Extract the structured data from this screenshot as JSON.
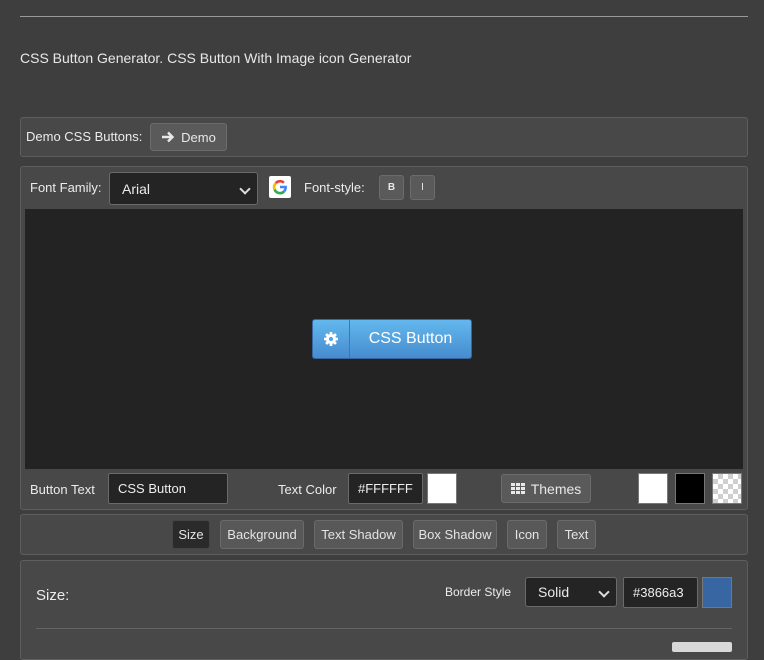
{
  "headline": "CSS Button Generator. CSS Button With Image icon Generator",
  "demo": {
    "label": "Demo CSS Buttons:",
    "button_label": "Demo"
  },
  "font": {
    "family_label": "Font Family:",
    "family_value": "Arial",
    "style_label": "Font-style:",
    "bold": "B",
    "italic": "I"
  },
  "preview": {
    "button_text": "CSS Button",
    "colors": {
      "bg_top": "#63b8ee",
      "bg_bottom": "#468ccf",
      "border": "#3866a3"
    }
  },
  "controls": {
    "button_text_label": "Button Text",
    "button_text_value": "CSS Button",
    "text_color_label": "Text Color",
    "text_color_value": "#FFFFFF",
    "themes_label": "Themes"
  },
  "tabs": [
    "Size",
    "Background",
    "Text Shadow",
    "Box Shadow",
    "Icon",
    "Text"
  ],
  "active_tab": "Size",
  "size_panel": {
    "title": "Size:",
    "border_style_label": "Border Style",
    "border_style_value": "Solid",
    "border_color_value": "#3866a3"
  }
}
